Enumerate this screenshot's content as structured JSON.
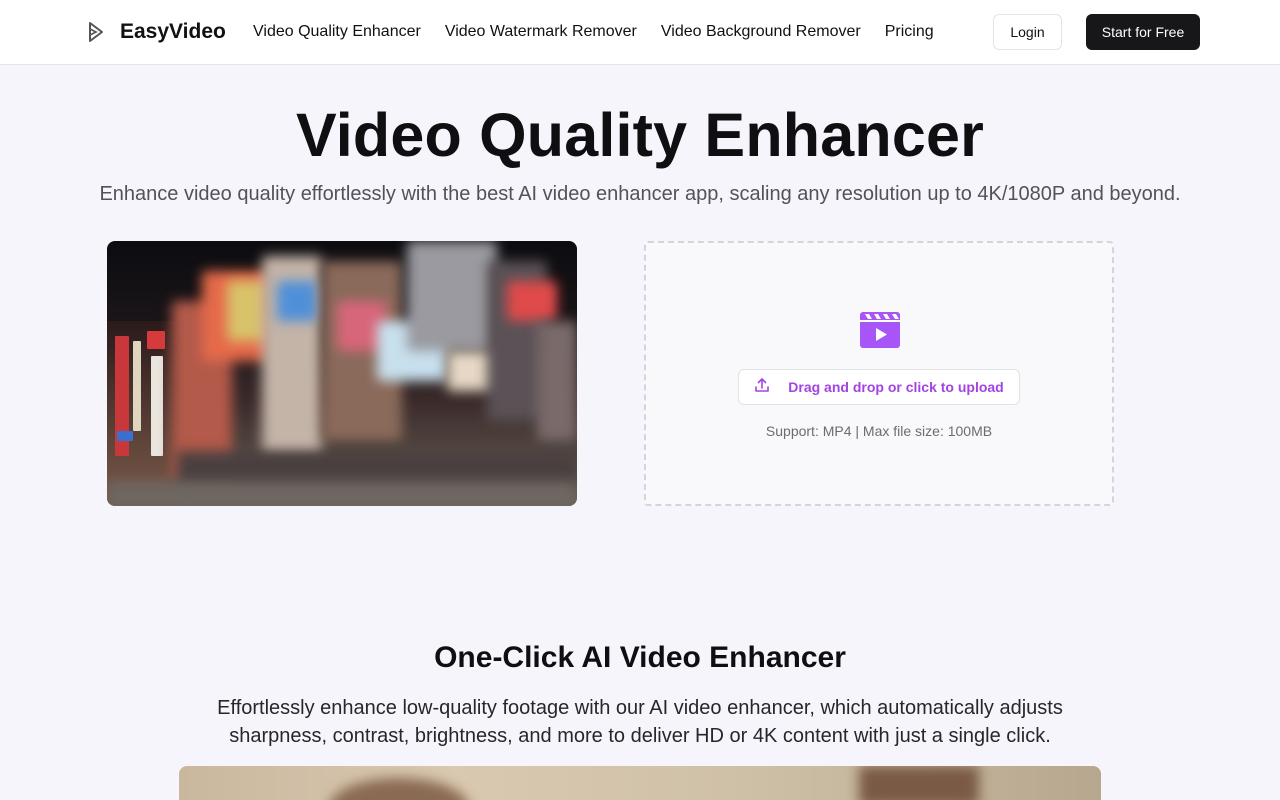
{
  "header": {
    "brand": "EasyVideo",
    "logo_icon": "play-outline-icon",
    "nav": [
      {
        "label": "Video Quality Enhancer"
      },
      {
        "label": "Video Watermark Remover"
      },
      {
        "label": "Video Background Remover"
      },
      {
        "label": "Pricing"
      }
    ],
    "login_label": "Login",
    "start_label": "Start for Free"
  },
  "hero": {
    "title": "Video Quality Enhancer",
    "subtitle": "Enhance video quality effortlessly with the best AI video enhancer app, scaling any resolution up to 4K/1080P and beyond."
  },
  "upload": {
    "icon": "clapperboard-icon",
    "button_icon": "upload-icon",
    "button_label": "Drag and drop or click to upload",
    "hint": "Support: MP4 | Max file size: 100MB"
  },
  "section": {
    "title": "One-Click AI Video Enhancer",
    "description": "Effortlessly enhance low-quality footage with our AI video enhancer, which automatically adjusts sharpness, contrast, brightness, and more to deliver HD or 4K content with just a single click."
  },
  "colors": {
    "accent": "#a343e3",
    "clapper": "#a855f7",
    "primary_button": "#17171a",
    "background": "#f7f5fc"
  }
}
